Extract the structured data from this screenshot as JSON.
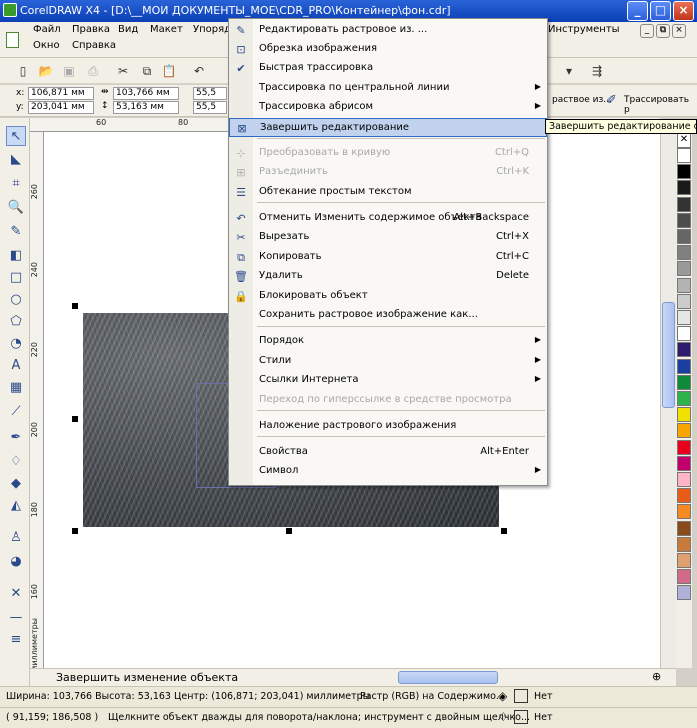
{
  "window": {
    "title": "CorelDRAW X4 - [D:\\__МОИ ДОКУМЕНТЫ_МОЕ\\CDR_PRO\\Контейнер\\фон.cdr]",
    "buttons": {
      "minimize": "_",
      "maximize": "□",
      "close": "×"
    }
  },
  "menubar": {
    "items": [
      "Файл",
      "Правка",
      "Вид",
      "Макет",
      "Упоряд",
      "Инструменты",
      "Окно",
      "Справка"
    ],
    "doc_buttons": {
      "minimize": "_",
      "restore": "⧉",
      "close": "×"
    }
  },
  "propbar": {
    "x_label": "x:",
    "x_value": "106,871 мм",
    "y_label": "y:",
    "y_value": "203,041 мм",
    "w_value": "103,766 мм",
    "h_value": "53,163 мм",
    "scale_x": "55,5",
    "scale_y": "55,5",
    "edit_text": "раствое из...",
    "trace_label": "Трассировать р"
  },
  "rulers": {
    "h_ticks": [
      "60",
      "80"
    ],
    "v_ticks": [
      "260",
      "240",
      "220",
      "200",
      "180",
      "160",
      "миллиметры"
    ]
  },
  "context_menu": {
    "items": [
      {
        "label": "Редактировать растровое из. ...",
        "icon": "edit-bitmap-icon",
        "glyph": "✎",
        "shortcut": "",
        "submenu": false,
        "disabled": false
      },
      {
        "label": "Обрезка изображения",
        "icon": "crop-bitmap-icon",
        "glyph": "⊡",
        "shortcut": "",
        "submenu": false,
        "disabled": false
      },
      {
        "label": "Быстрая трассировка",
        "icon": "quick-trace-icon",
        "glyph": "✔",
        "shortcut": "",
        "submenu": false,
        "disabled": false
      },
      {
        "label": "Трассировка по центральной линии",
        "icon": "",
        "glyph": "",
        "shortcut": "",
        "submenu": true,
        "disabled": false
      },
      {
        "label": "Трассировка абрисом",
        "icon": "",
        "glyph": "",
        "shortcut": "",
        "submenu": true,
        "disabled": false
      },
      {
        "label": "Завершить редактирование",
        "icon": "finish-edit-icon",
        "glyph": "⊠",
        "shortcut": "",
        "submenu": false,
        "disabled": false,
        "highlighted": true
      },
      {
        "label": "Преобразовать в кривую",
        "icon": "convert-curve-icon",
        "glyph": "⊹",
        "shortcut": "Ctrl+Q",
        "submenu": false,
        "disabled": true
      },
      {
        "label": "Разъединить",
        "icon": "break-apart-icon",
        "glyph": "⊞",
        "shortcut": "Ctrl+K",
        "submenu": false,
        "disabled": true
      },
      {
        "label": "Обтекание простым текстом",
        "icon": "text-wrap-icon",
        "glyph": "☰",
        "shortcut": "",
        "submenu": false,
        "disabled": false
      },
      {
        "label": "Отменить Изменить содержимое объекта",
        "icon": "undo-icon",
        "glyph": "↶",
        "shortcut": "Alt+Backspace",
        "submenu": false,
        "disabled": false
      },
      {
        "label": "Вырезать",
        "icon": "cut-icon",
        "glyph": "✂",
        "shortcut": "Ctrl+X",
        "submenu": false,
        "disabled": false
      },
      {
        "label": "Копировать",
        "icon": "copy-icon",
        "glyph": "⧉",
        "shortcut": "Ctrl+C",
        "submenu": false,
        "disabled": false
      },
      {
        "label": "Удалить",
        "icon": "delete-icon",
        "glyph": "🗑",
        "shortcut": "Delete",
        "submenu": false,
        "disabled": false
      },
      {
        "label": "Блокировать объект",
        "icon": "lock-icon",
        "glyph": "🔒",
        "shortcut": "",
        "submenu": false,
        "disabled": false
      },
      {
        "label": "Сохранить растровое изображение как...",
        "icon": "",
        "glyph": "",
        "shortcut": "",
        "submenu": false,
        "disabled": false
      },
      {
        "label": "Порядок",
        "icon": "",
        "glyph": "",
        "shortcut": "",
        "submenu": true,
        "disabled": false
      },
      {
        "label": "Стили",
        "icon": "",
        "glyph": "",
        "shortcut": "",
        "submenu": true,
        "disabled": false
      },
      {
        "label": "Ссылки Интернета",
        "icon": "",
        "glyph": "",
        "shortcut": "",
        "submenu": true,
        "disabled": false
      },
      {
        "label": "Переход по гиперссылке в средстве просмотра",
        "icon": "",
        "glyph": "",
        "shortcut": "",
        "submenu": false,
        "disabled": true
      },
      {
        "label": "Наложение растрового изображения",
        "icon": "",
        "glyph": "",
        "shortcut": "",
        "submenu": false,
        "disabled": false
      },
      {
        "label": "Свойства",
        "icon": "",
        "glyph": "",
        "shortcut": "Alt+Enter",
        "submenu": false,
        "disabled": false
      },
      {
        "label": "Символ",
        "icon": "",
        "glyph": "",
        "shortcut": "",
        "submenu": true,
        "disabled": false
      }
    ]
  },
  "tooltip": {
    "text": "Завершить редактирование содержимого"
  },
  "pagebar": {
    "text": "Завершить изменение объекта"
  },
  "status": {
    "line1": {
      "size": "Ширина: 103,766 Высота: 53,163 Центр: (106,871; 203,041)  миллиметры",
      "object": "Растр (RGB) на Содержимо...",
      "fill": "Нет"
    },
    "line2": {
      "coords": "( 91,159; 186,508 )",
      "hint": "Щелкните объект дважды для поворота/наклона; инструмент с двойным щелчко...",
      "outline": "Нет"
    }
  },
  "palette": {
    "colors": [
      "#ffffff",
      "#000000",
      "#1a1a1a",
      "#333333",
      "#4d4d4d",
      "#666666",
      "#808080",
      "#999999",
      "#b3b3b3",
      "#cccccc",
      "#e6e6e6",
      "#ffffff",
      "#2e1a6e",
      "#1a3fa0",
      "#0d8a3a",
      "#2db34a",
      "#f2e100",
      "#f7a600",
      "#e8001c",
      "#c2006b",
      "#ffb3c7",
      "#e85c1a",
      "#f58a22",
      "#8a4a1a",
      "#c87a3a",
      "#e0a070",
      "#d46a8a",
      "#b0b0d8"
    ]
  }
}
